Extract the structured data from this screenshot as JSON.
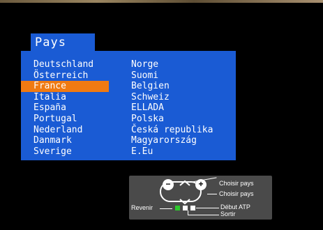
{
  "menu": {
    "title": "Pays",
    "selected_index": 2,
    "left_items": [
      "Deutschland",
      "Österreich",
      "France",
      "Italia",
      "España",
      "Portugal",
      "Nederland",
      "Danmark",
      "Sverige"
    ],
    "right_items": [
      "Norge",
      "Suomi",
      "Belgien",
      "Schweiz",
      "ELLADA",
      "Polska",
      "Česká republika",
      "Magyarország",
      "E.Eu"
    ]
  },
  "remote_help": {
    "minus_symbol": "−",
    "plus_symbol": "+",
    "choose_country_1": "Choisir pays",
    "choose_country_2": "Choisir pays",
    "back": "Revenir",
    "atp_start": "Début ATP",
    "exit": "Sortir"
  },
  "colors": {
    "panel": "#1a5bd4",
    "highlight": "#f07a12",
    "remote_bg": "#4a4a4a",
    "green_key": "#2ec82e"
  }
}
